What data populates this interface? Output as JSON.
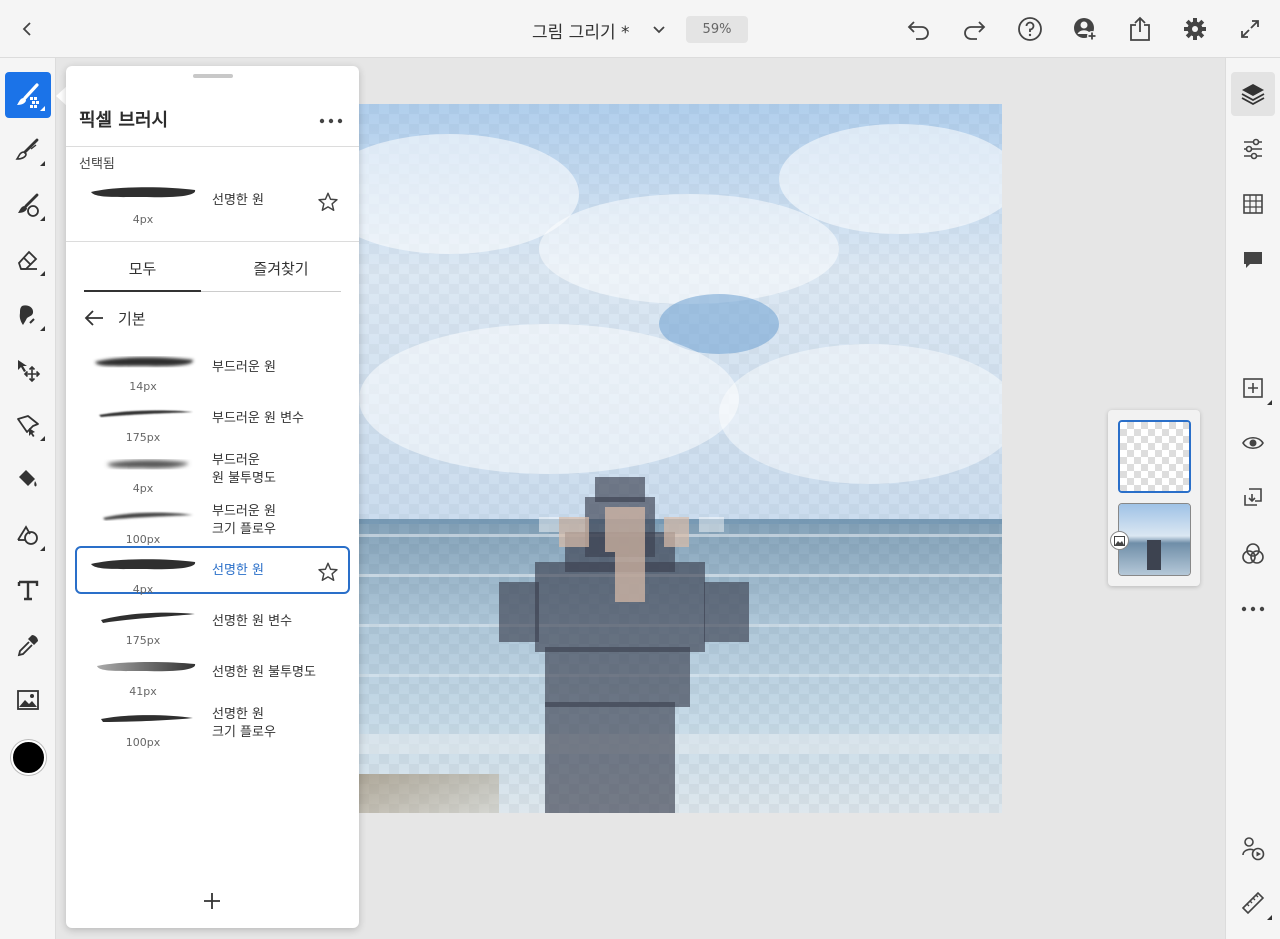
{
  "header": {
    "doc_title": "그림 그리기 *",
    "zoom": "59%",
    "icons": [
      "back-icon",
      "chevron-down-icon",
      "undo-icon",
      "redo-icon",
      "help-icon",
      "invite-user-icon",
      "share-icon",
      "settings-icon",
      "fullscreen-icon"
    ]
  },
  "left_toolbar": {
    "active_tool": "pixel-brush",
    "tools": [
      "pixel-brush",
      "live-brush",
      "vector-brush",
      "eraser",
      "smudge",
      "move-transform",
      "lasso-select",
      "fill",
      "shape",
      "text",
      "eyedropper",
      "place-image"
    ],
    "current_color": "#000000"
  },
  "right_toolbar": {
    "tools": [
      "layers",
      "layer-properties",
      "grid",
      "comments",
      "add-layer",
      "visibility",
      "merge-down",
      "blend-mode",
      "more",
      "livestream",
      "ruler"
    ]
  },
  "brush_panel": {
    "title": "픽셀 브러시",
    "selected_label": "선택됨",
    "selected_brush": {
      "name": "선명한 원",
      "size": "4px"
    },
    "tabs": {
      "all": "모두",
      "favorites": "즐겨찾기"
    },
    "category": "기본",
    "brushes": [
      {
        "name": "부드러운 원",
        "size": "14px"
      },
      {
        "name": "부드러운 원 변수",
        "size": "175px"
      },
      {
        "name_line1": "부드러운",
        "name_line2": "원 불투명도",
        "size": "4px"
      },
      {
        "name_line1": "부드러운 원",
        "name_line2": "크기 플로우",
        "size": "100px"
      },
      {
        "name": "선명한 원",
        "size": "4px",
        "selected": true
      },
      {
        "name": "선명한 원 변수",
        "size": "175px"
      },
      {
        "name": "선명한 원 불투명도",
        "size": "41px"
      },
      {
        "name_line1": "선명한 원",
        "name_line2": "크기 플로우",
        "size": "100px"
      }
    ]
  },
  "layers_panel": {
    "selected_layer": 0,
    "layer_count": 2
  },
  "colors": {
    "accent": "#1b73e8",
    "selection": "#2a6fc9"
  }
}
